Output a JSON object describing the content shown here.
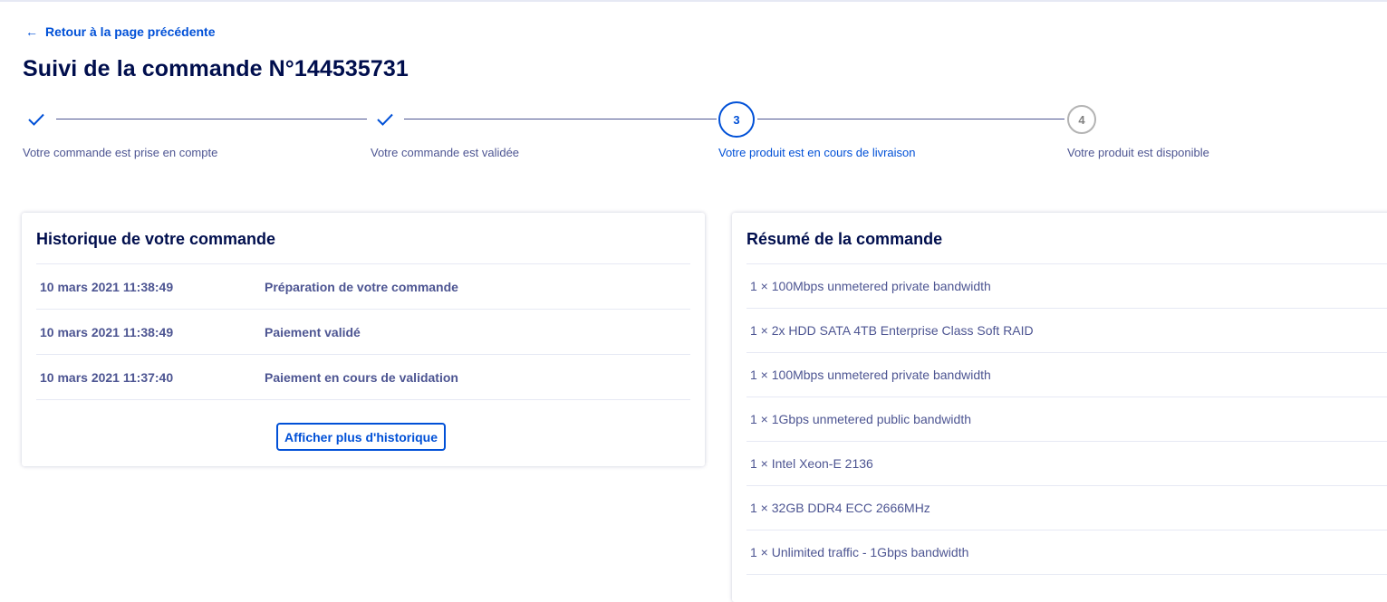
{
  "nav": {
    "back_label": "Retour à la page précédente"
  },
  "page": {
    "title": "Suivi de la commande N°144535731"
  },
  "stepper": {
    "steps": [
      {
        "label": "Votre commande est prise en compte",
        "state": "done",
        "icon": "check-icon"
      },
      {
        "label": "Votre commande est validée",
        "state": "done",
        "icon": "check-icon"
      },
      {
        "label": "Votre produit est en cours de livraison",
        "state": "current",
        "number": "3"
      },
      {
        "label": "Votre produit est disponible",
        "state": "todo",
        "number": "4"
      }
    ]
  },
  "history": {
    "title": "Historique de votre commande",
    "rows": [
      {
        "date": "10 mars 2021 11:38:49",
        "event": "Préparation de votre commande"
      },
      {
        "date": "10 mars 2021 11:38:49",
        "event": "Paiement validé"
      },
      {
        "date": "10 mars 2021 11:37:40",
        "event": "Paiement en cours de validation"
      }
    ],
    "more_label": "Afficher plus d'historique"
  },
  "summary": {
    "title": "Résumé de la commande",
    "items": [
      "1 × 100Mbps unmetered private bandwidth",
      "1 × 2x HDD SATA 4TB Enterprise Class Soft RAID",
      "1 × 100Mbps unmetered private bandwidth",
      "1 × 1Gbps unmetered public bandwidth",
      "1 × Intel Xeon-E 2136",
      "1 × 32GB DDR4 ECC 2666MHz",
      "1 × Unlimited traffic - 1Gbps bandwidth"
    ]
  },
  "colors": {
    "primary": "#0050d7",
    "heading": "#000e4d",
    "text": "#4d5592",
    "inactive": "#b3b3b3"
  }
}
